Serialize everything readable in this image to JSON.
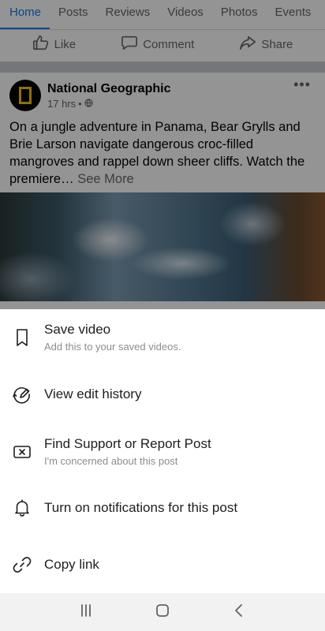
{
  "tabs": [
    {
      "label": "Home",
      "active": true
    },
    {
      "label": "Posts"
    },
    {
      "label": "Reviews"
    },
    {
      "label": "Videos"
    },
    {
      "label": "Photos"
    },
    {
      "label": "Events"
    }
  ],
  "actions": {
    "like": "Like",
    "comment": "Comment",
    "share": "Share"
  },
  "post": {
    "author": "National Geographic",
    "time": "17 hrs",
    "separator": "•",
    "text": "On a jungle adventure in Panama, Bear Grylls and Brie Larson navigate dangerous croc-filled mangroves and rappel down sheer cliffs. Watch the premiere…",
    "see_more": "See More",
    "more_menu": "•••"
  },
  "sheet": {
    "items": [
      {
        "label": "Save video",
        "sub": "Add this to your saved videos.",
        "icon": "bookmark-icon"
      },
      {
        "label": "View edit history",
        "sub": "",
        "icon": "edit-history-icon"
      },
      {
        "label": "Find Support or Report Post",
        "sub": "I'm concerned about this post",
        "icon": "report-icon"
      },
      {
        "label": "Turn on notifications for this post",
        "sub": "",
        "icon": "bell-icon"
      },
      {
        "label": "Copy link",
        "sub": "",
        "icon": "link-icon"
      }
    ]
  },
  "nav": {
    "recents": "recents-icon",
    "home": "home-icon",
    "back": "back-icon"
  },
  "colors": {
    "accent": "#1877f2",
    "brand_yellow": "#f4c60b",
    "scrim": "rgba(0,0,0,0.42)"
  }
}
